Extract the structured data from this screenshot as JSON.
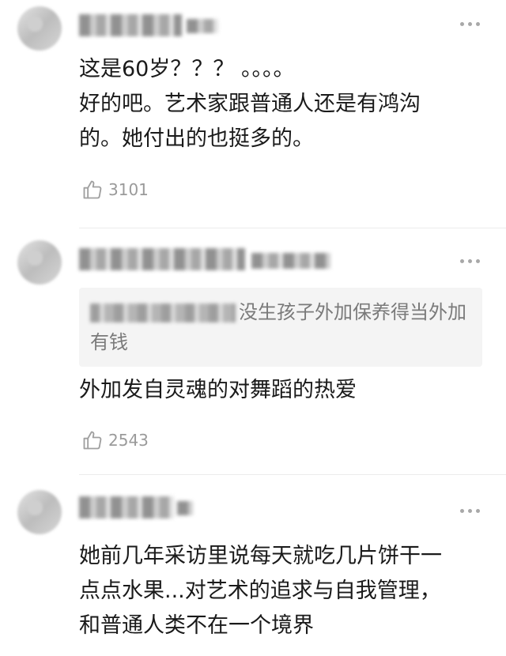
{
  "comments": [
    {
      "text": "这是60岁？？？ 。。。。\n好的吧。艺术家跟普通人还是有鸿沟\n的。她付出的也挺多的。",
      "likes": "3101"
    },
    {
      "quote_text": "没生孩子外加保养得当外加有钱",
      "text": "外加发自灵魂的对舞蹈的热爱",
      "likes": "2543"
    },
    {
      "text": "她前几年采访里说每天就吃几片饼干一\n点点水果...对艺术的追求与自我管理，\n和普通人类不在一个境界"
    }
  ],
  "icons": {
    "like": "thumbs-up-icon",
    "more": "more-dots-icon"
  },
  "colors": {
    "text": "#1a1a1a",
    "muted": "#9a9a9a",
    "quote_bg": "#f4f4f4"
  }
}
